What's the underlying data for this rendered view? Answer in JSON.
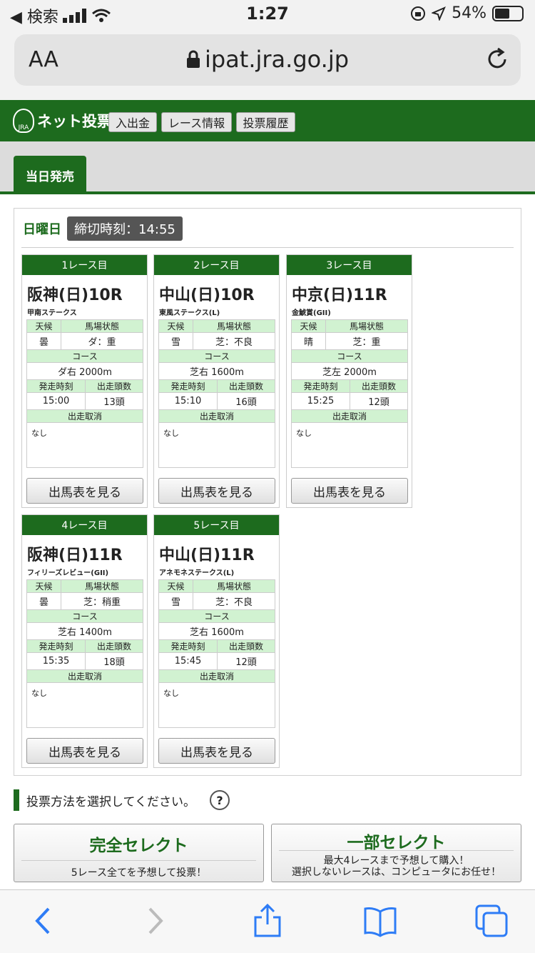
{
  "status": {
    "carrier": "◀ 検索",
    "time": "1:27",
    "battery": "54%"
  },
  "browser": {
    "aa": "AA",
    "url": "ipat.jra.go.jp"
  },
  "header": {
    "logo_text": "ネット投票",
    "logo_sub": "JRA",
    "buttons": [
      "入出金",
      "レース情報",
      "投票履歴"
    ]
  },
  "tab": {
    "label": "当日発売"
  },
  "panel": {
    "day": "日曜日",
    "deadline": "締切時刻：14:55"
  },
  "labels": {
    "weather": "天候",
    "track": "馬場状態",
    "course": "コース",
    "post_time": "発走時刻",
    "runners": "出走頭数",
    "scratch": "出走取消",
    "view_button": "出馬表を見る"
  },
  "races": [
    {
      "no": "1レース目",
      "venue": "阪神(日)10R",
      "name": "甲南ステークス",
      "weather": "曇",
      "track": "ダ：重",
      "course": "ダ右 2000m",
      "time": "15:00",
      "runners": "13頭",
      "scratch": "なし"
    },
    {
      "no": "2レース目",
      "venue": "中山(日)10R",
      "name": "東風ステークス(L)",
      "weather": "雪",
      "track": "芝：不良",
      "course": "芝右 1600m",
      "time": "15:10",
      "runners": "16頭",
      "scratch": "なし"
    },
    {
      "no": "3レース目",
      "venue": "中京(日)11R",
      "name": "金鯱賞(GII)",
      "weather": "晴",
      "track": "芝：重",
      "course": "芝左 2000m",
      "time": "15:25",
      "runners": "12頭",
      "scratch": "なし"
    },
    {
      "no": "4レース目",
      "venue": "阪神(日)11R",
      "name": "フィリーズレビュー(GII)",
      "weather": "曇",
      "track": "芝：稍重",
      "course": "芝右 1400m",
      "time": "15:35",
      "runners": "18頭",
      "scratch": "なし"
    },
    {
      "no": "5レース目",
      "venue": "中山(日)11R",
      "name": "アネモネステークス(L)",
      "weather": "雪",
      "track": "芝：不良",
      "course": "芝右 1600m",
      "time": "15:45",
      "runners": "12頭",
      "scratch": "なし"
    }
  ],
  "guide": {
    "text": "投票方法を選択してください。",
    "help": "?"
  },
  "select_all": {
    "title": "完全セレクト",
    "desc": "5レース全てを予想して投票！"
  },
  "select_part": {
    "title": "一部セレクト",
    "desc1": "最大4レースまで予想して購入！",
    "desc2": "選択しないレースは、コンピュータにお任せ！"
  },
  "colors": {
    "green": "#1d6b1e",
    "header_bg": "#d1f2d1",
    "ios_blue": "#2e7cf6"
  }
}
